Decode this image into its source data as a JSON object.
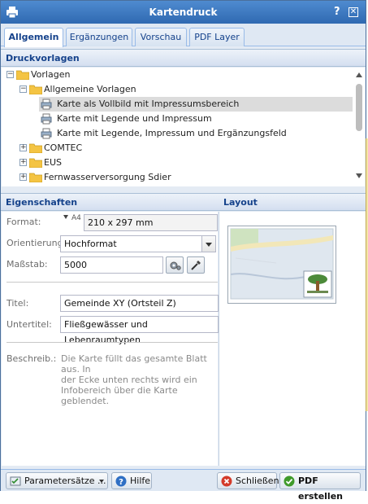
{
  "window": {
    "title": "Kartendruck",
    "help_glyph": "?",
    "close_glyph": "✕"
  },
  "tabs": [
    {
      "label": "Allgemein",
      "active": true
    },
    {
      "label": "Ergänzungen",
      "active": false
    },
    {
      "label": "Vorschau",
      "active": false
    },
    {
      "label": "PDF Layer",
      "active": false
    }
  ],
  "templates": {
    "header": "Druckvorlagen",
    "tree": [
      {
        "label": "Vorlagen",
        "type": "folder",
        "expanded": true
      },
      {
        "label": "Allgemeine Vorlagen",
        "type": "folder",
        "expanded": true
      },
      {
        "label": "Karte als Vollbild mit Impressumsbereich",
        "type": "template",
        "selected": true
      },
      {
        "label": "Karte mit Legende und Impressum",
        "type": "template"
      },
      {
        "label": "Karte mit Legende, Impressum und Ergänzungsfeld",
        "type": "template"
      },
      {
        "label": "COMTEC",
        "type": "folder",
        "expanded": false
      },
      {
        "label": "EUS",
        "type": "folder",
        "expanded": false
      },
      {
        "label": "Fernwasserversorgung Sdier",
        "type": "folder",
        "expanded": false
      }
    ]
  },
  "properties": {
    "header": "Eigenschaften",
    "format_label": "Format:",
    "format_paper": "A4",
    "format_value": "210 x 297 mm",
    "orientation_label": "Orientierung:",
    "orientation_value": "Hochformat",
    "scale_label": "Maßstab:",
    "scale_value": "5000",
    "title_label": "Titel:",
    "title_value": "Gemeinde XY (Ortsteil Z)",
    "subtitle_label": "Untertitel:",
    "subtitle_value": "Fließgewässer und Lebenraumtypen",
    "description_label": "Beschreib.:",
    "description_lines": [
      "Die Karte füllt das gesamte Blatt aus. In",
      "der Ecke unten rechts wird ein",
      "Infobereich über die Karte geblendet."
    ]
  },
  "layout": {
    "header": "Layout"
  },
  "footer": {
    "parameter_sets_label": "Parametersätze ...",
    "help_label": "Hilfe",
    "close_label": "Schließen",
    "create_pdf_label": "PDF erstellen"
  },
  "colors": {
    "title_bar": "#3a76be",
    "accent_text": "#15428b",
    "folder": "#f4c443",
    "close_red": "#d43b2a",
    "ok_green": "#3f9a2a"
  }
}
